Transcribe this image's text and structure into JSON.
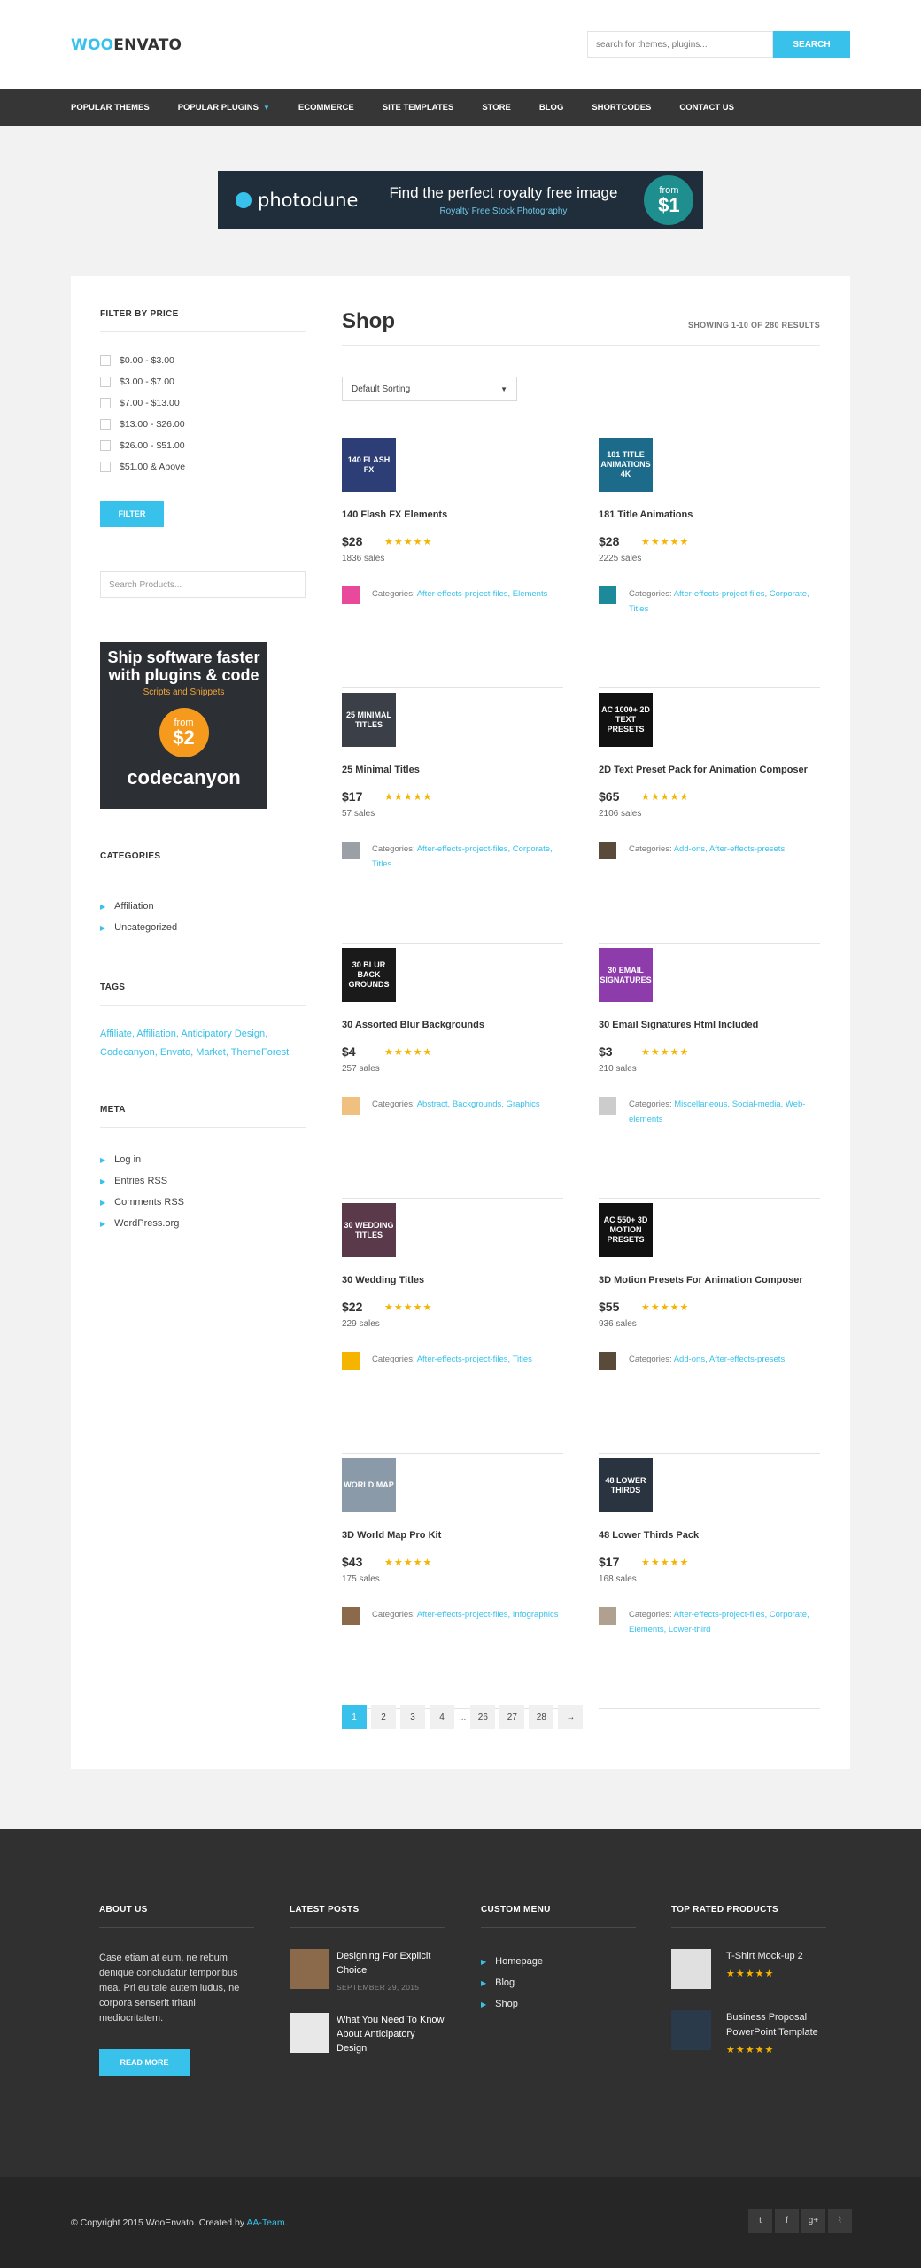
{
  "header": {
    "logo_part1": "WOO",
    "logo_part2": "ENVATO",
    "search_placeholder": "search for themes, plugins...",
    "search_button": "SEARCH"
  },
  "nav": [
    {
      "label": "POPULAR THEMES"
    },
    {
      "label": "POPULAR PLUGINS"
    },
    {
      "label": "ECOMMERCE"
    },
    {
      "label": "SITE TEMPLATES"
    },
    {
      "label": "STORE"
    },
    {
      "label": "BLOG"
    },
    {
      "label": "SHORTCODES"
    },
    {
      "label": "CONTACT US"
    }
  ],
  "banner": {
    "brand": "photodune",
    "headline": "Find the perfect royalty free image",
    "sub": "Royalty Free Stock Photography",
    "from": "from",
    "price": "$1"
  },
  "sidebar": {
    "filter_title": "FILTER BY PRICE",
    "price_ranges": [
      "$0.00  -  $3.00",
      "$3.00  -  $7.00",
      "$7.00  -  $13.00",
      "$13.00  -  $26.00",
      "$26.00  -  $51.00",
      "$51.00  &  Above"
    ],
    "filter_button": "FILTER",
    "search_placeholder": "Search Products...",
    "ad": {
      "headline": "Ship software faster with plugins & code",
      "sub": "Scripts and Snippets",
      "from": "from",
      "price": "$2",
      "brand": "codecanyon"
    },
    "categories_title": "CATEGORIES",
    "categories": [
      "Affiliation",
      "Uncategorized"
    ],
    "tags_title": "TAGS",
    "tags": "Affiliate, Affiliation, Anticipatory Design, Codecanyon, Envato, Market, ThemeForest",
    "meta_title": "META",
    "meta": [
      "Log in",
      "Entries RSS",
      "Comments RSS",
      "WordPress.org"
    ]
  },
  "shop": {
    "title": "Shop",
    "showing": "SHOWING 1-10 OF 280 RESULTS",
    "sorting": "Default Sorting",
    "categories_label": "Categories: ",
    "products": [
      {
        "name": "140 Flash FX Elements",
        "price": "$28",
        "sales": "1836 sales",
        "stars": "★★★★★",
        "cats": "After-effects-project-files, Elements",
        "thumb_text": "140 FLASH FX",
        "thumb_color": "#2c3e75",
        "author_color": "#e8499a"
      },
      {
        "name": "181 Title Animations",
        "price": "$28",
        "sales": "2225 sales",
        "stars": "★★★★★",
        "cats": "After-effects-project-files, Corporate, Titles",
        "thumb_text": "181 TITLE ANIMATIONS 4K",
        "thumb_color": "#1d6b8a",
        "author_color": "#1d8a9a"
      },
      {
        "name": "25 Minimal Titles",
        "price": "$17",
        "sales": "57 sales",
        "stars": "★★★★★",
        "cats": "After-effects-project-files, Corporate, Titles",
        "thumb_text": "25 MINIMAL TITLES",
        "thumb_color": "#3b3f47",
        "author_color": "#9aa0a6"
      },
      {
        "name": "2D Text Preset Pack for Animation Composer",
        "price": "$65",
        "sales": "2106 sales",
        "stars": "★★★★★",
        "cats": "Add-ons, After-effects-presets",
        "thumb_text": "AC 1000+ 2D TEXT PRESETS",
        "thumb_color": "#111111",
        "author_color": "#5a4a3a"
      },
      {
        "name": "30 Assorted Blur Backgrounds",
        "price": "$4",
        "sales": "257 sales",
        "stars": "★★★★★",
        "cats": "Abstract, Backgrounds, Graphics",
        "thumb_text": "30 BLUR BACK GROUNDS",
        "thumb_color": "#1a1a1a",
        "author_color": "#f0c080"
      },
      {
        "name": "30 Email Signatures Html Included",
        "price": "$3",
        "sales": "210 sales",
        "stars": "★★★★★",
        "cats": "Miscellaneous, Social-media, Web-elements",
        "thumb_text": "30 EMAIL SIGNATURES",
        "thumb_color": "#8e3cab",
        "author_color": "#cccccc"
      },
      {
        "name": "30 Wedding Titles",
        "price": "$22",
        "sales": "229 sales",
        "stars": "★★★★★",
        "cats": "After-effects-project-files, Titles",
        "thumb_text": "30 WEDDING TITLES",
        "thumb_color": "#5a3a4a",
        "author_color": "#f4b400"
      },
      {
        "name": "3D Motion Presets For Animation Composer",
        "price": "$55",
        "sales": "936 sales",
        "stars": "★★★★★",
        "cats": "Add-ons, After-effects-presets",
        "thumb_text": "AC 550+ 3D MOTION PRESETS",
        "thumb_color": "#111111",
        "author_color": "#5a4a3a"
      },
      {
        "name": "3D World Map Pro Kit",
        "price": "$43",
        "sales": "175 sales",
        "stars": "★★★★★",
        "cats": "After-effects-project-files, Infographics",
        "thumb_text": "WORLD MAP",
        "thumb_color": "#8a9aa8",
        "author_color": "#8a6a4a"
      },
      {
        "name": "48 Lower Thirds Pack",
        "price": "$17",
        "sales": "168 sales",
        "stars": "★★★★★",
        "cats": "After-effects-project-files, Corporate, Elements, Lower-third",
        "thumb_text": "48 LOWER THIRDS",
        "thumb_color": "#2a3440",
        "author_color": "#b0a090"
      }
    ],
    "pages": [
      "1",
      "2",
      "3",
      "4",
      "26",
      "27",
      "28",
      "→"
    ],
    "dots": "..."
  },
  "footer": {
    "about_title": "ABOUT US",
    "about_text": "Case etiam at eum, ne rebum denique concludatur temporibus mea. Pri eu tale autem ludus, ne corpora senserit tritani mediocritatem.",
    "read_more": "READ MORE",
    "posts_title": "LATEST POSTS",
    "posts": [
      {
        "title": "Designing For Explicit Choice",
        "date": "SEPTEMBER 29, 2015"
      },
      {
        "title": "What You Need To Know About Anticipatory Design",
        "date": ""
      }
    ],
    "menu_title": "CUSTOM MENU",
    "menu": [
      "Homepage",
      "Blog",
      "Shop"
    ],
    "top_title": "TOP RATED PRODUCTS",
    "top_products": [
      {
        "name": "T-Shirt Mock-up 2",
        "stars": "★★★★★"
      },
      {
        "name": "Business Proposal PowerPoint Template",
        "stars": "★★★★★"
      }
    ]
  },
  "bottom": {
    "copyright": "© Copyright 2015 WooEnvato. Created by ",
    "author_link": "AA-Team",
    "period": ".",
    "social": [
      "twitter-icon",
      "facebook-icon",
      "google-plus-icon",
      "rss-icon"
    ],
    "social_glyphs": [
      "t",
      "f",
      "g+",
      "⌇"
    ]
  },
  "colors": {
    "accent": "#38c1ea",
    "dark": "#363636",
    "footer": "#303030",
    "stars": "#f4b400"
  }
}
